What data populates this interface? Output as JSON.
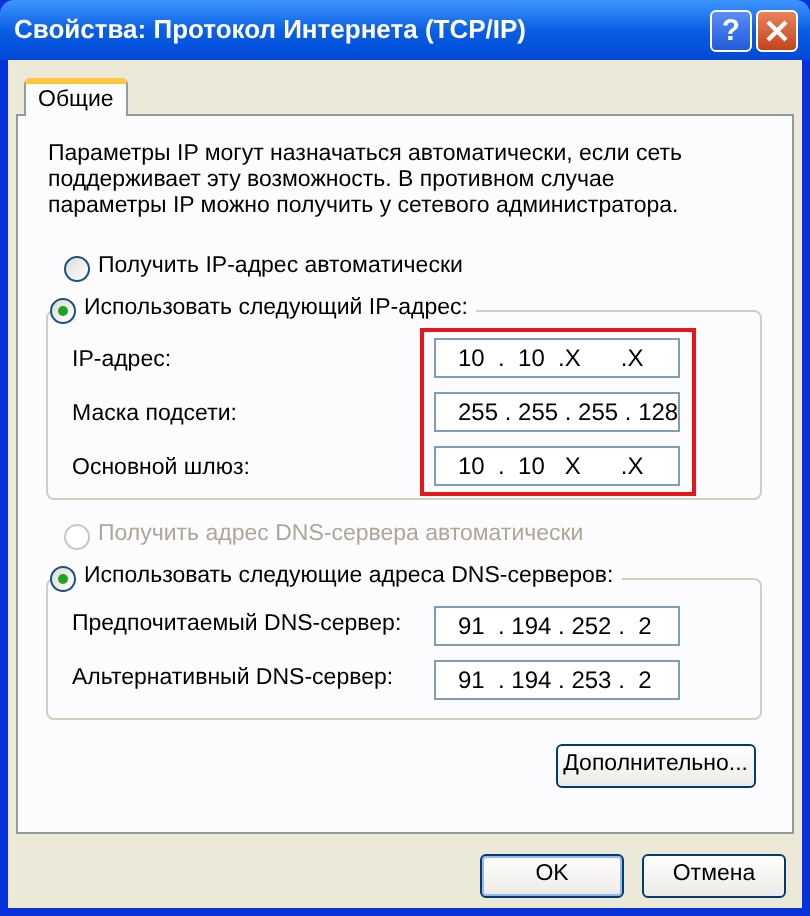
{
  "window": {
    "title": "Свойства: Протокол Интернета (TCP/IP)",
    "help": "?"
  },
  "tabs": [
    {
      "label": "Общие",
      "selected": true
    }
  ],
  "description": "Параметры IP могут назначаться автоматически, если сеть поддерживает эту возможность. В противном случае параметры IP можно получить у сетевого администратора.",
  "ip_mode": [
    {
      "label": "Получить IP-адрес автоматически",
      "selected": false,
      "disabled": false
    },
    {
      "label": "Использовать следующий IP-адрес:",
      "selected": true,
      "disabled": false
    }
  ],
  "ip_fields_highlighted": true,
  "ip_fields": [
    {
      "label": "IP-адрес:",
      "value": "10  .  10  .X      .X"
    },
    {
      "label": "Маска подсети:",
      "value": "255 . 255 . 255 . 128"
    },
    {
      "label": "Основной шлюз:",
      "value": "10  .  10   X      .X"
    }
  ],
  "dns_mode": [
    {
      "label": "Получить адрес DNS-сервера автоматически",
      "selected": false,
      "disabled": true
    },
    {
      "label": "Использовать следующие адреса DNS-серверов:",
      "selected": true,
      "disabled": false
    }
  ],
  "dns_fields": [
    {
      "label": "Предпочитаемый DNS-сервер:",
      "value": "91  . 194 . 252 .  2"
    },
    {
      "label": "Альтернативный DNS-сервер:",
      "value": "91  . 194 . 253 .  2"
    }
  ],
  "advanced_button": "Дополнительно...",
  "buttons": [
    {
      "label": "OK",
      "default": true
    },
    {
      "label": "Отмена",
      "default": false
    }
  ]
}
